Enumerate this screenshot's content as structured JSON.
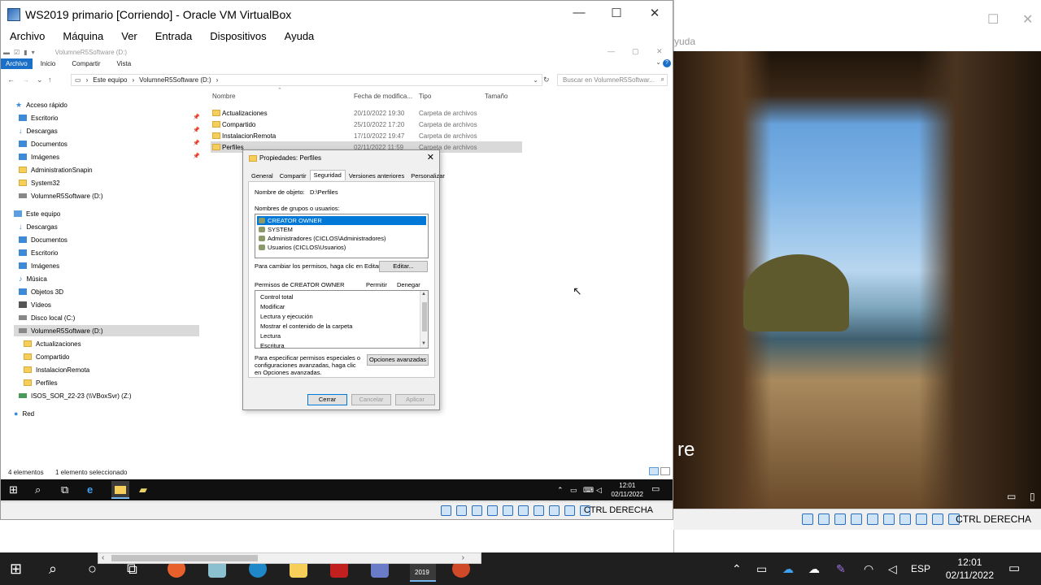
{
  "host": {
    "bg_window": {
      "menu_partial": "yuda",
      "text_partial": "re",
      "status_ctrl": "CTRL DERECHA"
    },
    "taskbar": {
      "lang": "ESP",
      "time": "12:01",
      "date": "02/11/2022",
      "vbox_badge": "2019"
    }
  },
  "vbox": {
    "title": "WS2019 primario [Corriendo] - Oracle VM VirtualBox",
    "menu": [
      "Archivo",
      "Máquina",
      "Ver",
      "Entrada",
      "Dispositivos",
      "Ayuda"
    ],
    "status_ctrl": "CTRL DERECHA"
  },
  "guest": {
    "window_title": "VolumneR5Software (D:)",
    "ribbon": [
      "Archivo",
      "Inicio",
      "Compartir",
      "Vista"
    ],
    "address": [
      "Este equipo",
      "VolumneR5Software (D:)"
    ],
    "search_placeholder": "Buscar en VolumneR5Softwar...",
    "nav": {
      "quick_access": "Acceso rápido",
      "quick_items": [
        "Escritorio",
        "Descargas",
        "Documentos",
        "Imágenes",
        "AdministrationSnapin",
        "System32",
        "VolumneR5Software (D:)"
      ],
      "this_pc": "Este equipo",
      "pc_items": [
        "Descargas",
        "Documentos",
        "Escritorio",
        "Imágenes",
        "Música",
        "Objetos 3D",
        "Vídeos",
        "Disco local (C:)",
        "VolumneR5Software (D:)"
      ],
      "drive_children": [
        "Actualizaciones",
        "Compartido",
        "InstalacionRemota",
        "Perfiles"
      ],
      "network_drive": "ISOS_SOR_22-23 (\\\\VBoxSvr) (Z:)",
      "network": "Red"
    },
    "columns": [
      "Nombre",
      "Fecha de modifica...",
      "Tipo",
      "Tamaño"
    ],
    "files": [
      {
        "name": "Actualizaciones",
        "date": "20/10/2022 19:30",
        "type": "Carpeta de archivos"
      },
      {
        "name": "Compartido",
        "date": "25/10/2022 17:20",
        "type": "Carpeta de archivos"
      },
      {
        "name": "InstalacionRemota",
        "date": "17/10/2022 19:47",
        "type": "Carpeta de archivos"
      },
      {
        "name": "Perfiles",
        "date": "02/11/2022 11:59",
        "type": "Carpeta de archivos"
      }
    ],
    "status_items": "4 elementos",
    "status_selected": "1 elemento seleccionado",
    "clock": {
      "time": "12:01",
      "date": "02/11/2022"
    }
  },
  "dialog": {
    "title": "Propiedades: Perfiles",
    "tabs": [
      "General",
      "Compartir",
      "Seguridad",
      "Versiones anteriores",
      "Personalizar"
    ],
    "object_label": "Nombre de objeto:",
    "object_value": "D:\\Perfiles",
    "groups_label": "Nombres de grupos o usuarios:",
    "users": [
      "CREATOR OWNER",
      "SYSTEM",
      "Administradores (CICLOS\\Administradores)",
      "Usuarios (CICLOS\\Usuarios)"
    ],
    "change_text": "Para cambiar los permisos, haga clic en Editar.",
    "edit_button": "Editar...",
    "perm_header": "Permisos de CREATOR OWNER",
    "allow": "Permitir",
    "deny": "Denegar",
    "permissions": [
      "Control total",
      "Modificar",
      "Lectura y ejecución",
      "Mostrar el contenido de la carpeta",
      "Lectura",
      "Escritura"
    ],
    "special_text": [
      "Para especificar permisos especiales o",
      "configuraciones avanzadas, haga clic",
      "en Opciones avanzadas."
    ],
    "advanced_button": "Opciones avanzadas",
    "close_button": "Cerrar",
    "cancel_button": "Cancelar",
    "apply_button": "Aplicar"
  }
}
